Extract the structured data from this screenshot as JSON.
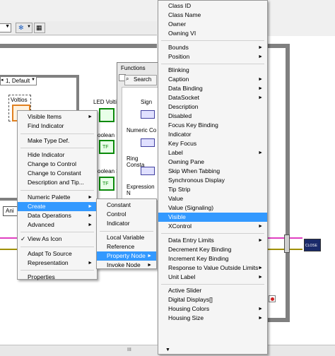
{
  "toolbar": {
    "dropdown1": "",
    "dropdown2": ""
  },
  "diagram": {
    "case_selector": "1, Default",
    "voltios_label": "Voltios",
    "led_label": "LED Volti",
    "boolean_label_1": "oolean",
    "boolean_label_2": "oolean 3",
    "tf_text": "TF",
    "ani_label": "Ani",
    "close_label": "CLOSE",
    "bottom_marker": "III"
  },
  "functions_palette": {
    "title": "Functions",
    "search_label": "Search",
    "items": [
      "Sign",
      "Numeric Co",
      "Ring Consta",
      "Expression N"
    ]
  },
  "context_menu": {
    "items": [
      {
        "label": "Visible Items",
        "arrow": true
      },
      {
        "label": "Find Indicator",
        "arrow": false
      },
      {
        "sep": true
      },
      {
        "label": "Make Type Def.",
        "arrow": false
      },
      {
        "sep": true
      },
      {
        "label": "Hide Indicator",
        "arrow": false
      },
      {
        "label": "Change to Control",
        "arrow": false
      },
      {
        "label": "Change to Constant",
        "arrow": false
      },
      {
        "label": "Description and Tip...",
        "arrow": false
      },
      {
        "sep": true
      },
      {
        "label": "Numeric Palette",
        "arrow": true
      },
      {
        "label": "Create",
        "arrow": true,
        "highlight": true
      },
      {
        "label": "Data Operations",
        "arrow": true
      },
      {
        "label": "Advanced",
        "arrow": true
      },
      {
        "sep": true
      },
      {
        "label": "View As Icon",
        "arrow": false,
        "check": true
      },
      {
        "sep": true
      },
      {
        "label": "Adapt To Source",
        "arrow": false
      },
      {
        "label": "Representation",
        "arrow": true
      },
      {
        "sep": true
      },
      {
        "label": "Properties",
        "arrow": false
      }
    ],
    "check_glyph": "✓"
  },
  "create_menu": {
    "items": [
      {
        "label": "Constant",
        "arrow": false
      },
      {
        "label": "Control",
        "arrow": false
      },
      {
        "label": "Indicator",
        "arrow": false
      },
      {
        "sep": true
      },
      {
        "label": "Local Variable",
        "arrow": false
      },
      {
        "label": "Reference",
        "arrow": false
      },
      {
        "label": "Property Node",
        "arrow": true,
        "highlight": true
      },
      {
        "label": "Invoke Node",
        "arrow": true
      }
    ]
  },
  "property_menu": {
    "items": [
      {
        "label": "Class ID",
        "arrow": false
      },
      {
        "label": "Class Name",
        "arrow": false
      },
      {
        "label": "Owner",
        "arrow": false
      },
      {
        "label": "Owning VI",
        "arrow": false
      },
      {
        "sep": true
      },
      {
        "label": "Bounds",
        "arrow": true
      },
      {
        "label": "Position",
        "arrow": true
      },
      {
        "sep": true
      },
      {
        "label": "Blinking",
        "arrow": false
      },
      {
        "label": "Caption",
        "arrow": true
      },
      {
        "label": "Data Binding",
        "arrow": true
      },
      {
        "label": "DataSocket",
        "arrow": true
      },
      {
        "label": "Description",
        "arrow": false
      },
      {
        "label": "Disabled",
        "arrow": false
      },
      {
        "label": "Focus Key Binding",
        "arrow": false
      },
      {
        "label": "Indicator",
        "arrow": false
      },
      {
        "label": "Key Focus",
        "arrow": false
      },
      {
        "label": "Label",
        "arrow": true
      },
      {
        "label": "Owning Pane",
        "arrow": false
      },
      {
        "label": "Skip When Tabbing",
        "arrow": false
      },
      {
        "label": "Synchronous Display",
        "arrow": false
      },
      {
        "label": "Tip Strip",
        "arrow": false
      },
      {
        "label": "Value",
        "arrow": false
      },
      {
        "label": "Value (Signaling)",
        "arrow": false
      },
      {
        "label": "Visible",
        "arrow": false,
        "highlight": true
      },
      {
        "label": "XControl",
        "arrow": true
      },
      {
        "sep": true
      },
      {
        "label": "Data Entry Limits",
        "arrow": true
      },
      {
        "label": "Decrement Key Binding",
        "arrow": false
      },
      {
        "label": "Increment Key Binding",
        "arrow": false
      },
      {
        "label": "Response to Value Outside Limits",
        "arrow": true
      },
      {
        "label": "Unit Label",
        "arrow": true
      },
      {
        "sep": true
      },
      {
        "label": "Active Slider",
        "arrow": false
      },
      {
        "label": "Digital Displays[]",
        "arrow": false
      },
      {
        "label": "Housing Colors",
        "arrow": true
      },
      {
        "label": "Housing Size",
        "arrow": true
      }
    ],
    "arrow_glyph": "►",
    "scroll_up": "▲",
    "scroll_down": "▼"
  },
  "colors": {
    "highlight": "#3399ff",
    "wire_pink": "#e040c0",
    "wire_olive": "#a09000",
    "wire_green": "#008000",
    "frame": "#808080"
  }
}
